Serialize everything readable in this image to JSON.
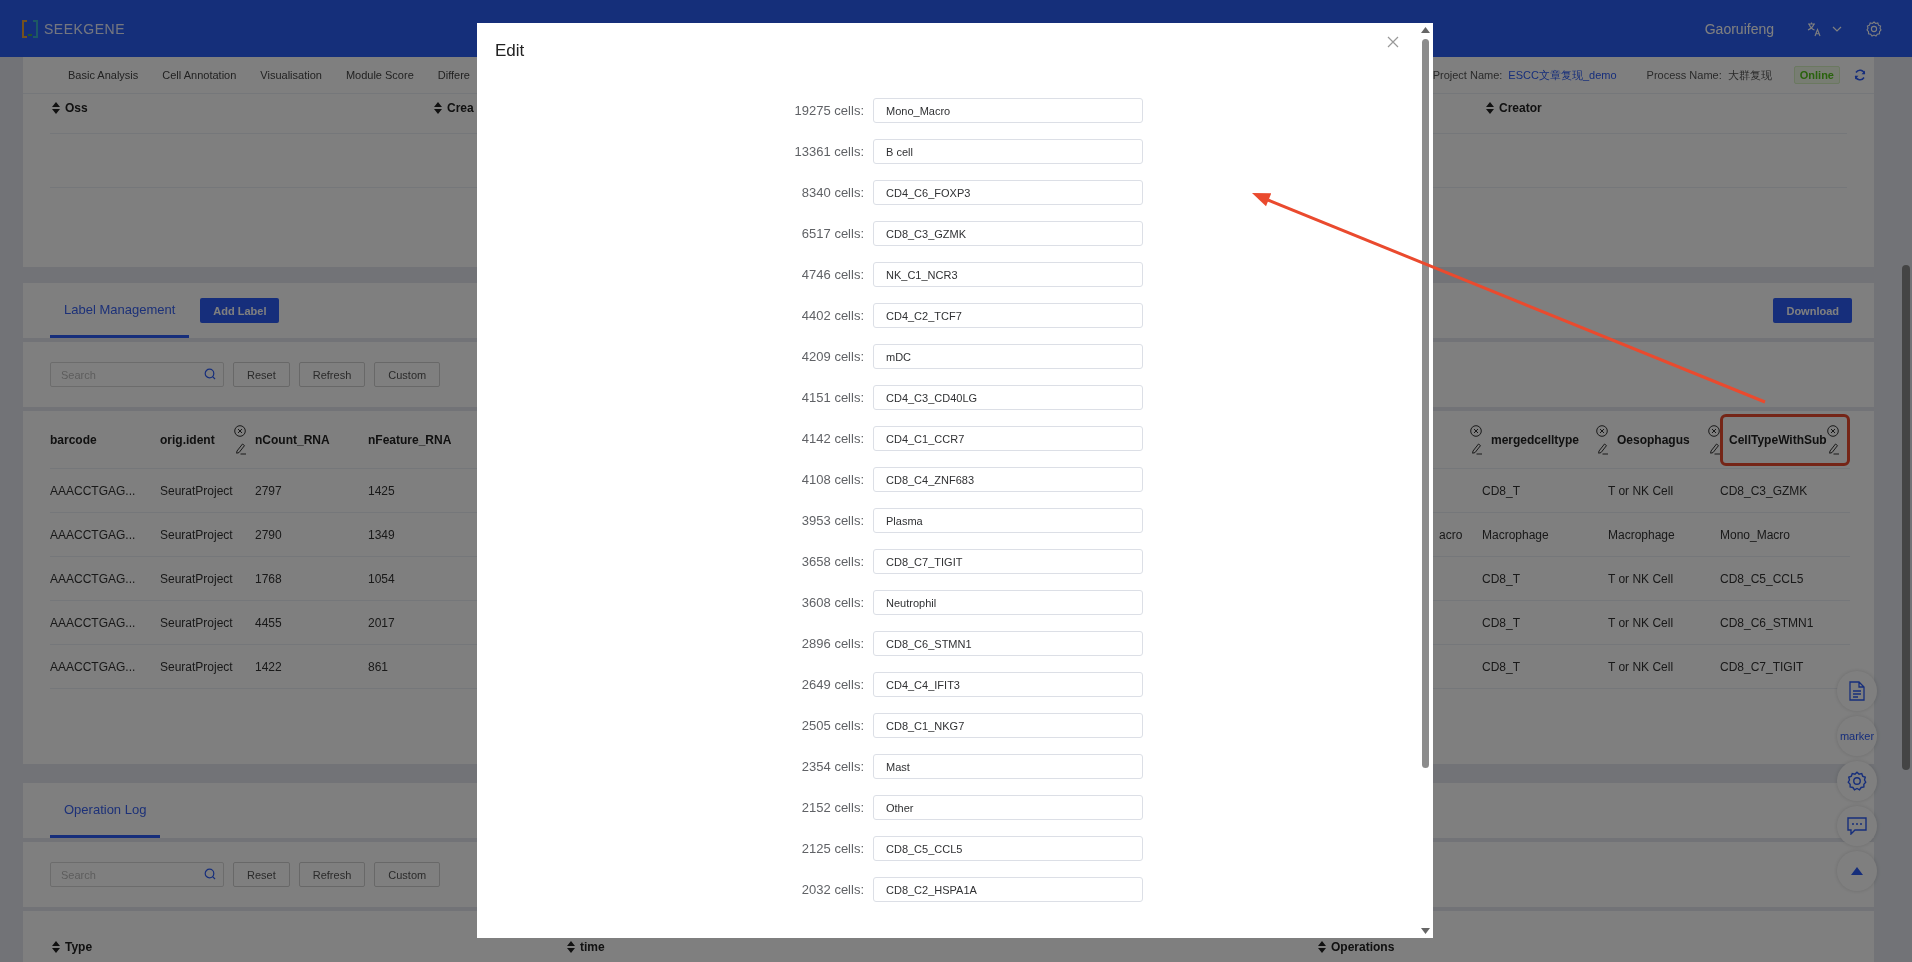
{
  "header": {
    "logo": "SEEKGENE",
    "user": "Gaoruifeng"
  },
  "subnav": {
    "tabs": [
      {
        "label": "Basic Analysis",
        "selected": false
      },
      {
        "label": "Cell Annotation",
        "selected": false
      },
      {
        "label": "Visualisation",
        "selected": false
      },
      {
        "label": "Module Score",
        "selected": false
      },
      {
        "label": "Differe",
        "selected": false
      }
    ],
    "project_label": "Project Name:",
    "project_name": "ESCC文章复现_demo",
    "process_label": "Process Name:",
    "process_name": "大群复现",
    "status": "Online"
  },
  "top_table": {
    "columns": [
      "Oss",
      "Crea",
      "Creator"
    ]
  },
  "label_management": {
    "tab": "Label Management",
    "add_button": "Add Label",
    "download_button": "Download",
    "search": {
      "placeholder": "Search"
    },
    "buttons": [
      "Reset",
      "Refresh",
      "Custom"
    ],
    "columns": [
      {
        "label": "barcode",
        "editable": false,
        "highlighted": false
      },
      {
        "label": "orig.ident",
        "editable": true,
        "highlighted": false
      },
      {
        "label": "nCount_RNA",
        "editable": false,
        "highlighted": false
      },
      {
        "label": "nFeature_RNA",
        "editable": false,
        "highlighted": false
      },
      {
        "editable": true,
        "highlighted": false
      },
      {
        "label": "mergedcelltype",
        "editable": true,
        "highlighted": false
      },
      {
        "label": "Oesophagus",
        "editable": true,
        "highlighted": false
      },
      {
        "label": "CellTypeWithSub",
        "editable": true,
        "highlighted": true
      }
    ],
    "rows": [
      {
        "barcode": "AAACCTGAG...",
        "orig_ident": "SeuratProject",
        "nCount_RNA": "2797",
        "nFeature_RNA": "1425",
        "mergedcelltype": "CD8_T",
        "Oesophagus": "T or NK Cell",
        "CellTypeWithSub": "CD8_C3_GZMK"
      },
      {
        "barcode": "AAACCTGAG...",
        "orig_ident": "SeuratProject",
        "nCount_RNA": "2790",
        "nFeature_RNA": "1349",
        "column_5": "acro",
        "mergedcelltype": "Macrophage",
        "Oesophagus": "Macrophage",
        "CellTypeWithSub": "Mono_Macro"
      },
      {
        "barcode": "AAACCTGAG...",
        "orig_ident": "SeuratProject",
        "nCount_RNA": "1768",
        "nFeature_RNA": "1054",
        "mergedcelltype": "CD8_T",
        "Oesophagus": "T or NK Cell",
        "CellTypeWithSub": "CD8_C5_CCL5"
      },
      {
        "barcode": "AAACCTGAG...",
        "orig_ident": "SeuratProject",
        "nCount_RNA": "4455",
        "nFeature_RNA": "2017",
        "mergedcelltype": "CD8_T",
        "Oesophagus": "T or NK Cell",
        "CellTypeWithSub": "CD8_C6_STMN1"
      },
      {
        "barcode": "AAACCTGAG...",
        "orig_ident": "SeuratProject",
        "nCount_RNA": "1422",
        "nFeature_RNA": "861",
        "mergedcelltype": "CD8_T",
        "Oesophagus": "T or NK Cell",
        "CellTypeWithSub": "CD8_C7_TIGIT"
      }
    ]
  },
  "operation_log": {
    "tab": "Operation Log",
    "search": {
      "placeholder": "Search"
    },
    "buttons": [
      "Reset",
      "Refresh",
      "Custom"
    ],
    "columns": [
      "Type",
      "time",
      "Operations"
    ]
  },
  "side_buttons": {
    "marker": "marker"
  },
  "modal": {
    "title": "Edit",
    "rows": [
      {
        "count": "19275 cells:",
        "value": "Mono_Macro"
      },
      {
        "count": "13361 cells:",
        "value": "B cell"
      },
      {
        "count": "8340 cells:",
        "value": "CD4_C6_FOXP3"
      },
      {
        "count": "6517 cells:",
        "value": "CD8_C3_GZMK"
      },
      {
        "count": "4746 cells:",
        "value": "NK_C1_NCR3"
      },
      {
        "count": "4402 cells:",
        "value": "CD4_C2_TCF7"
      },
      {
        "count": "4209 cells:",
        "value": "mDC"
      },
      {
        "count": "4151 cells:",
        "value": "CD4_C3_CD40LG"
      },
      {
        "count": "4142 cells:",
        "value": "CD4_C1_CCR7"
      },
      {
        "count": "4108 cells:",
        "value": "CD8_C4_ZNF683"
      },
      {
        "count": "3953 cells:",
        "value": "Plasma"
      },
      {
        "count": "3658 cells:",
        "value": "CD8_C7_TIGIT"
      },
      {
        "count": "3608 cells:",
        "value": "Neutrophil"
      },
      {
        "count": "2896 cells:",
        "value": "CD8_C6_STMN1"
      },
      {
        "count": "2649 cells:",
        "value": "CD4_C4_IFIT3"
      },
      {
        "count": "2505 cells:",
        "value": "CD8_C1_NKG7"
      },
      {
        "count": "2354 cells:",
        "value": "Mast"
      },
      {
        "count": "2152 cells:",
        "value": "Other"
      },
      {
        "count": "2125 cells:",
        "value": "CD8_C5_CCL5"
      },
      {
        "count": "2032 cells:",
        "value": "CD8_C2_HSPA1A"
      }
    ]
  }
}
